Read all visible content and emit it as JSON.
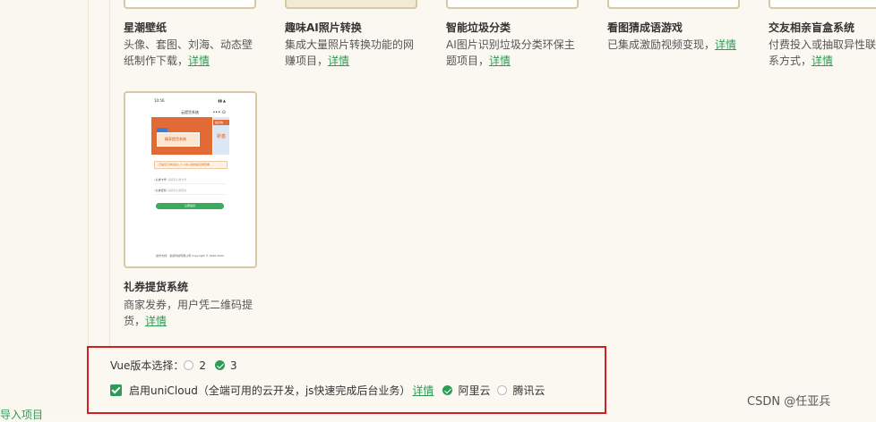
{
  "left_panel": {
    "import_link": "导入项目"
  },
  "cards": [
    {
      "title": "星潮壁纸",
      "desc": "头像、套图、刘海、动态壁纸制作下载，",
      "detail": "详情"
    },
    {
      "title": "趣味AI照片转换",
      "desc": "集成大量照片转换功能的网赚项目，",
      "detail": "详情"
    },
    {
      "title": "智能垃圾分类",
      "desc": "AI图片识别垃圾分类环保主题项目，",
      "detail": "详情"
    },
    {
      "title": "看图猜成语游戏",
      "desc": "已集成激励视频变现，",
      "detail": "详情"
    },
    {
      "title": "交友相亲盲盒系统",
      "desc": "付费投入或抽取异性联系方式，",
      "detail": "详情"
    },
    {
      "title": "礼券提货系统",
      "desc": "商家发券，用户凭二维码提货，",
      "detail": "详情"
    }
  ],
  "phone_mock": {
    "time": "10:56",
    "signal": "▮▮ ▲",
    "title": "云提货系统",
    "icons": "••• ⊙",
    "banner_text": "精享提货系统",
    "side_ribbon": "提货卷",
    "side_text": "新春",
    "notice": "已提货订单请进入个人中心我的提货单查看",
    "field1_label": "•礼券卡号",
    "field1_placeholder": "请填写礼券卡号",
    "field2_label": "•礼券密码",
    "field2_placeholder": "请填写礼券密码",
    "button": "立即提货",
    "footer": "技术支持：某某科技有限公司 Copyright © 2020-2022"
  },
  "settings": {
    "vue_label": "Vue版本选择：",
    "vue_options": [
      "2",
      "3"
    ],
    "vue_selected": "3",
    "unicloud_label": "启用uniCloud（全端可用的云开发，js快速完成后台业务）",
    "unicloud_checked": true,
    "detail_link": "详情",
    "providers": [
      "阿里云",
      "腾讯云"
    ],
    "provider_selected": "阿里云"
  },
  "watermark": "CSDN @任亚兵",
  "colors": {
    "accent": "#2e9a56",
    "highlight_border": "#d02025",
    "thumb_border": "#d6c9a3"
  }
}
